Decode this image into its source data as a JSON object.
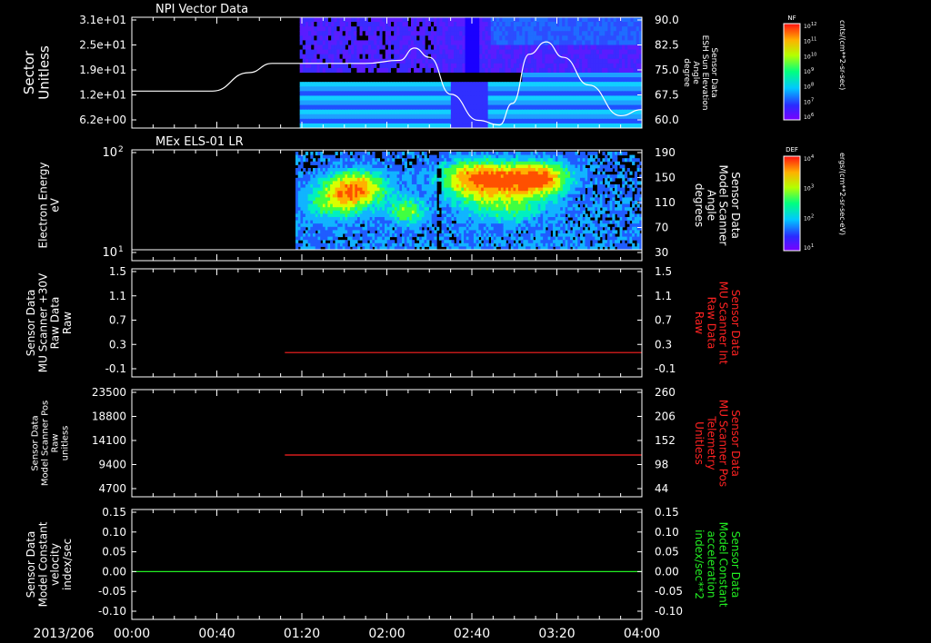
{
  "timeline": {
    "date_label": "2013/206",
    "ticks": [
      "00:00",
      "00:40",
      "01:20",
      "02:00",
      "02:40",
      "03:20",
      "04:00"
    ],
    "start_min": 0,
    "end_min": 240
  },
  "chart_data": [
    {
      "type": "heatmap",
      "title": "NPI Vector Data",
      "ylabel": [
        "Sector",
        "Unitless"
      ],
      "y_ticks": [
        "3.1e+01",
        "2.5e+01",
        "1.9e+01",
        "1.2e+01",
        "6.2e+00"
      ],
      "y2label": [
        "Sensor Data",
        "ESH Sun Elevation",
        "Angle",
        "degree"
      ],
      "y2_ticks": [
        "90.0",
        "82.5",
        "75.0",
        "67.5",
        "60.0"
      ],
      "y2lim": [
        54,
        90
      ],
      "colorbar": {
        "label": "NF",
        "units": "cnts/(cm**2-sr-sec)",
        "ticks": [
          "10^12",
          "10^11",
          "10^10",
          "10^9",
          "10^8",
          "10^7",
          "10^6"
        ]
      },
      "data_start_min": 79,
      "overlay_series": {
        "name": "ESH Sun Elevation Angle",
        "x_min": [
          0,
          38,
          55,
          66,
          80,
          110,
          126,
          133,
          140,
          150,
          163,
          173,
          179,
          187,
          195,
          203,
          215,
          230,
          240
        ],
        "y_deg": [
          66.0,
          66.0,
          72.0,
          75.0,
          75.0,
          75.0,
          76.0,
          80.0,
          77.0,
          65.0,
          56.5,
          55.0,
          62.0,
          78.0,
          82.0,
          77.0,
          68.0,
          58.0,
          60.0
        ]
      }
    },
    {
      "type": "heatmap",
      "title": "MEx ELS-01 LR",
      "ylabel": [
        "Electron Energy",
        "eV"
      ],
      "y_ticks": [
        "10^2",
        "10^1"
      ],
      "y2label": [
        "Sensor Data",
        "Model Scanner",
        "Angle",
        "degrees"
      ],
      "y2_ticks": [
        "190",
        "150",
        "110",
        "70",
        "30"
      ],
      "y2lim": [
        4,
        190
      ],
      "colorbar": {
        "label": "DEF",
        "units": "ergs/(cm**2-sr-sec-eV)",
        "ticks": [
          "10^4",
          "10^3",
          "10^2",
          "10^1"
        ]
      },
      "data_start_min": 77,
      "overlay_series": {
        "name": "Model Scanner Angle",
        "x_min": [
          0,
          240
        ],
        "y_deg": [
          4,
          4
        ]
      }
    },
    {
      "type": "line",
      "ylabel": [
        "Sensor Data",
        "MU Scanner +30V",
        "Raw Data",
        "Raw"
      ],
      "y_ticks": [
        "1.5",
        "1.1",
        "0.7",
        "0.3",
        "-0.1"
      ],
      "ylim": [
        -0.3,
        1.5
      ],
      "y2label": [
        "Sensor Data",
        "MU Scanner Int",
        "Raw Data",
        "Raw"
      ],
      "y2_ticks": [
        "1.5",
        "1.1",
        "0.7",
        "0.3",
        "-0.1"
      ],
      "y2label_color": "#ff2222",
      "series": [
        {
          "x_min": [
            72,
            240
          ],
          "values": [
            0,
            0
          ],
          "color": "#ff2222"
        }
      ]
    },
    {
      "type": "line",
      "ylabel": [
        "Sensor Data",
        "Model Scanner Pos",
        "Raw",
        "unitless"
      ],
      "y_ticks": [
        "23500",
        "18800",
        "14100",
        "9400",
        "4700"
      ],
      "ylim": [
        0,
        23500
      ],
      "y2label": [
        "Sensor Data",
        "MU Scanner Pos",
        "Telemetry",
        "Unitless"
      ],
      "y2_ticks": [
        "260",
        "206",
        "152",
        "98",
        "44"
      ],
      "y2label_color": "#ff2222",
      "series": [
        {
          "x_min": [
            72,
            240
          ],
          "values": [
            8200,
            8200
          ],
          "color": "#ff2222"
        }
      ]
    },
    {
      "type": "line",
      "ylabel": [
        "Sensor Data",
        "Model Constant",
        "velocity",
        "index/sec"
      ],
      "y_ticks": [
        "0.15",
        "0.10",
        "0.05",
        "0.00",
        "-0.05",
        "-0.10"
      ],
      "ylim": [
        -0.1,
        0.15
      ],
      "y2label": [
        "Sensor Data",
        "Model Constant",
        "acceleration",
        "index/sec**2"
      ],
      "y2_ticks": [
        "0.15",
        "0.10",
        "0.05",
        "0.00",
        "-0.05",
        "-0.10"
      ],
      "y2label_color": "#22ee22",
      "series": [
        {
          "x_min": [
            0,
            240
          ],
          "values": [
            0,
            0
          ],
          "color": "#22ee22"
        }
      ]
    }
  ]
}
